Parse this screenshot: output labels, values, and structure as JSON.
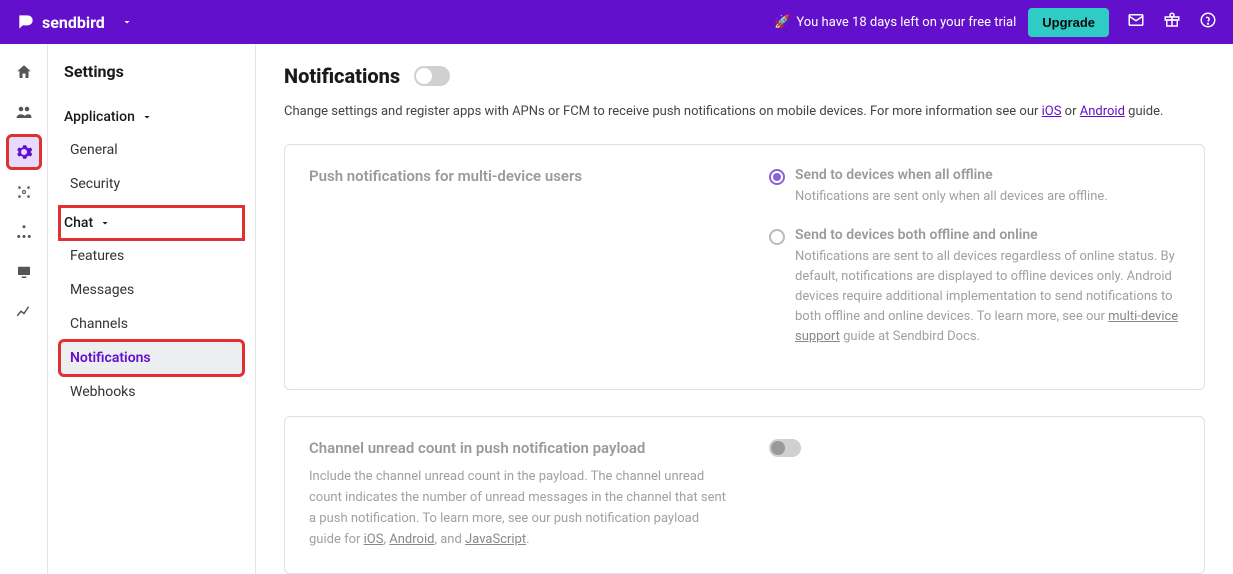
{
  "topbar": {
    "brand": "sendbird",
    "trial_rocket": "🚀",
    "trial_text": "You have 18 days left on your free trial",
    "upgrade_label": "Upgrade"
  },
  "sidebar": {
    "title": "Settings",
    "groups": {
      "application": {
        "label": "Application",
        "items": [
          "General",
          "Security"
        ]
      },
      "chat": {
        "label": "Chat",
        "items": [
          "Features",
          "Messages",
          "Channels",
          "Notifications",
          "Webhooks"
        ]
      }
    }
  },
  "page": {
    "title": "Notifications",
    "intro_pre": "Change settings and register apps with APNs or FCM to receive push notifications on mobile devices. For more information see our ",
    "intro_ios": "iOS",
    "intro_or": " or ",
    "intro_android": "Android",
    "intro_post": " guide."
  },
  "card1": {
    "title": "Push notifications for multi-device users",
    "opt1": {
      "label": "Send to devices when all offline",
      "desc": "Notifications are sent only when all devices are offline."
    },
    "opt2": {
      "label": "Send to devices both offline and online",
      "desc_pre": "Notifications are sent to all devices regardless of online status. By default, notifications are displayed to offline devices only. Android devices require additional implementation to send notifications to both offline and online devices. To learn more, see our ",
      "desc_link": "multi-device support",
      "desc_post": " guide at Sendbird Docs."
    }
  },
  "card2": {
    "title": "Channel unread count in push notification payload",
    "desc_pre": "Include the channel unread count in the payload. The channel unread count indicates the number of unread messages in the channel that sent a push notification. To learn more, see our push notification payload guide for ",
    "link_ios": "iOS",
    "sep1": ", ",
    "link_android": "Android",
    "sep2": ", and ",
    "link_js": "JavaScript",
    "desc_post": "."
  }
}
